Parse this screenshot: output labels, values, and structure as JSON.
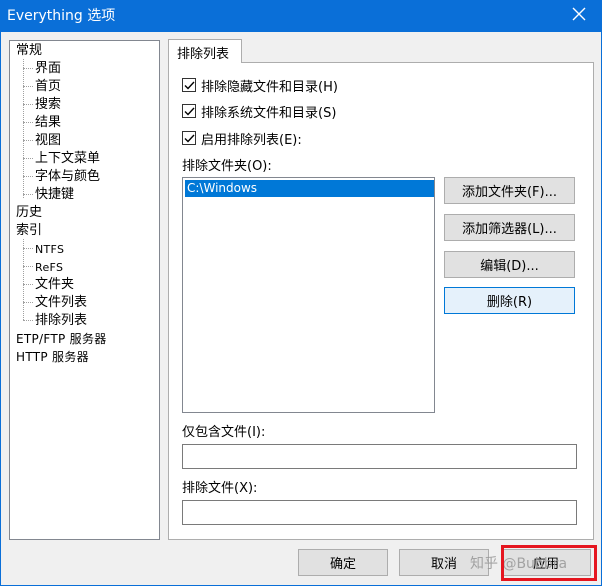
{
  "window": {
    "title": "Everything 选项",
    "close_glyph": "✕"
  },
  "tree": {
    "items": [
      {
        "label": "常规"
      },
      {
        "label": "界面"
      },
      {
        "label": "首页"
      },
      {
        "label": "搜索"
      },
      {
        "label": "结果"
      },
      {
        "label": "视图"
      },
      {
        "label": "上下文菜单"
      },
      {
        "label": "字体与颜色"
      },
      {
        "label": "快捷键"
      },
      {
        "label": "历史"
      },
      {
        "label": "索引"
      },
      {
        "label": "NTFS"
      },
      {
        "label": "ReFS"
      },
      {
        "label": "文件夹"
      },
      {
        "label": "文件列表"
      },
      {
        "label": "排除列表"
      },
      {
        "label": "ETP/FTP 服务器"
      },
      {
        "label": "HTTP 服务器"
      }
    ]
  },
  "tab": {
    "label": "排除列表"
  },
  "options": {
    "exclude_hidden": {
      "label": "排除隐藏文件和目录(H)",
      "checked": true
    },
    "exclude_system": {
      "label": "排除系统文件和目录(S)",
      "checked": true
    },
    "enable_exclude_list": {
      "label": "启用排除列表(E):",
      "checked": true
    }
  },
  "exclude_folders": {
    "label": "排除文件夹(O):",
    "items": [
      "C:\\Windows"
    ],
    "buttons": {
      "add_folder": "添加文件夹(F)...",
      "add_filter": "添加筛选器(L)...",
      "edit": "编辑(D)...",
      "remove": "删除(R)"
    }
  },
  "include_only": {
    "label": "仅包含文件(I):",
    "value": ""
  },
  "exclude_files": {
    "label": "排除文件(X):",
    "value": ""
  },
  "footer": {
    "ok": "确定",
    "cancel": "取消",
    "apply": "应用",
    "watermark": "知乎 @Bubbra"
  },
  "colors": {
    "titlebar": "#0a6fd8",
    "selection": "#0078d7",
    "highlight_box": "#e5151f"
  }
}
